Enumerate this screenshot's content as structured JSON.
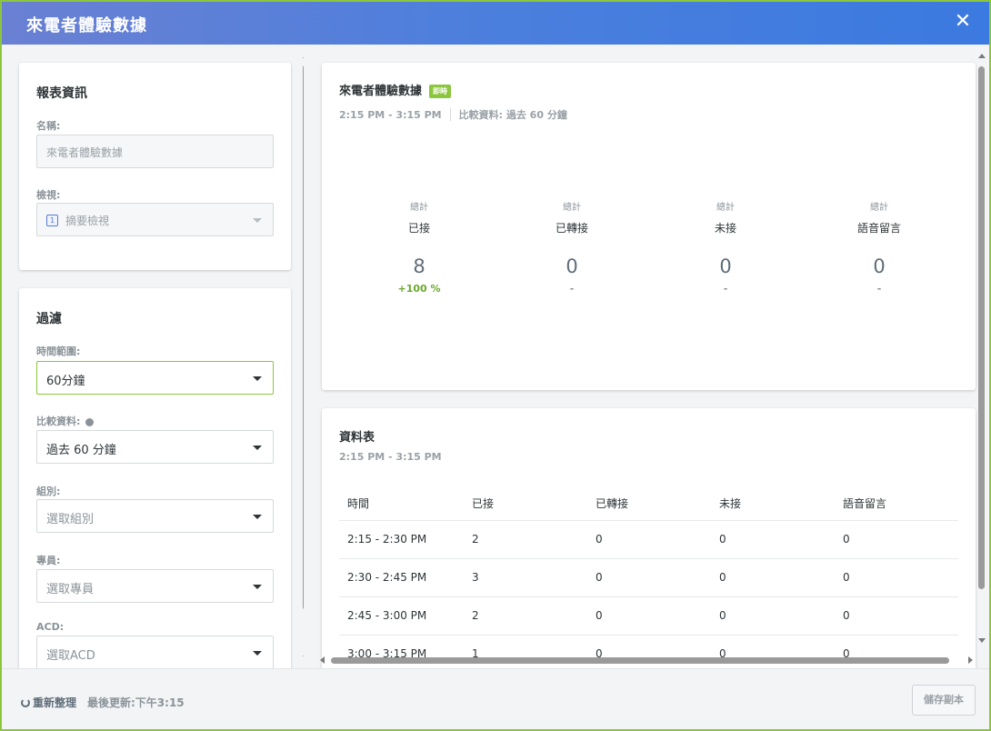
{
  "window": {
    "title": "來電者體驗數據",
    "close_label": "✕"
  },
  "report_info": {
    "heading": "報表資訊",
    "name_label": "名稱:",
    "name_value": "來電者體驗數據",
    "view_label": "檢視:",
    "view_icon_text": "1",
    "view_value": "摘要檢視"
  },
  "filters": {
    "heading": "過濾",
    "time_range_label": "時間範圍:",
    "time_range_value": "60分鐘",
    "compare_label": "比較資料:",
    "compare_value": "過去 60 分鐘",
    "group_label": "組別:",
    "group_placeholder": "選取組別",
    "agent_label": "專員:",
    "agent_placeholder": "選取專員",
    "acd_label": "ACD:",
    "acd_placeholder": "選取ACD"
  },
  "summary": {
    "title": "來電者體驗數據",
    "badge": "即時",
    "time_range": "2:15 PM - 3:15 PM",
    "compare_text": "比較資料: 過去 60 分鐘",
    "stats": [
      {
        "caption": "總計",
        "name": "已接",
        "value": "8",
        "delta": "+100 %"
      },
      {
        "caption": "總計",
        "name": "已轉接",
        "value": "0",
        "delta": "-"
      },
      {
        "caption": "總計",
        "name": "未接",
        "value": "0",
        "delta": "-"
      },
      {
        "caption": "總計",
        "name": "語音留言",
        "value": "0",
        "delta": "-"
      }
    ]
  },
  "table": {
    "title": "資料表",
    "time_range": "2:15 PM - 3:15 PM",
    "columns": [
      "時間",
      "已接",
      "已轉接",
      "未接",
      "語音留言"
    ],
    "rows": [
      [
        "2:15 - 2:30 PM",
        "2",
        "0",
        "0",
        "0"
      ],
      [
        "2:30 - 2:45 PM",
        "3",
        "0",
        "0",
        "0"
      ],
      [
        "2:45 - 3:00 PM",
        "2",
        "0",
        "0",
        "0"
      ],
      [
        "3:00 - 3:15 PM",
        "1",
        "0",
        "0",
        "0"
      ]
    ]
  },
  "footer": {
    "refresh_label": "重新整理",
    "last_updated": "最後更新:下午3:15",
    "save_copy_label": "儲存副本"
  },
  "colors": {
    "accent": "#8cc63f",
    "header_start": "#6a80d3",
    "header_end": "#3b7ae0",
    "positive": "#6aa82d"
  },
  "icons": {
    "close": "close-icon",
    "refresh": "refresh-icon",
    "info": "info-icon",
    "dropdown": "caret-down-icon"
  }
}
